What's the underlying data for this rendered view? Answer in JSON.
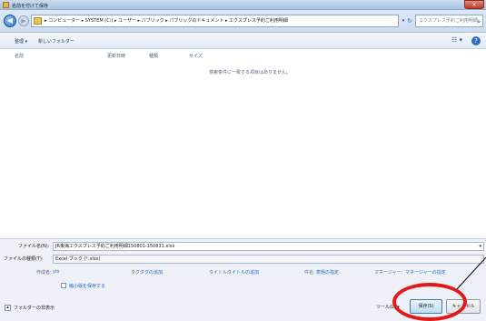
{
  "window": {
    "title": "名前を付けて保存",
    "close_label": "×"
  },
  "address": {
    "path": "▸ コンピューター ▸ SYSTEM (C:) ▸ ユーザー ▸ パブリック ▸ パブリックのドキュメント ▸ エクスプレス予約ご利用明細",
    "search_placeholder": "エクスプレス予約ご利用明細..."
  },
  "toolbar": {
    "organize": "整理 ▾",
    "new_folder": "新しいフォルダー",
    "view": "☷ ▾",
    "help": "?"
  },
  "columns": [
    "名前",
    "更新日時",
    "種類",
    "サイズ"
  ],
  "empty_message": "検索条件に一致する項目はありません。",
  "file": {
    "name_label": "ファイル名(N):",
    "name_value": "JR東海エクスプレス予約ご利用明細150801-150831.xlsx",
    "type_label": "ファイルの種類(T):",
    "type_value": "Excel ブック (*.xlsx)"
  },
  "meta": {
    "author_label": "作成者:",
    "author_value": "yio",
    "tags_label": "タグ:",
    "tags_value": "タグの追加",
    "title_label": "タイトル:",
    "title_value": "タイトルの追加",
    "subject_label": "件名:",
    "subject_value": "表題の指定",
    "manager_label": "マネージャー:",
    "manager_value": "マネージャーの指定"
  },
  "thumbnail_label": "縮小版を保存する",
  "hide_folders": "フォルダーの非表示",
  "tools": "ツール(L) ▾",
  "save": "保存(S)",
  "cancel": "キャンセル"
}
